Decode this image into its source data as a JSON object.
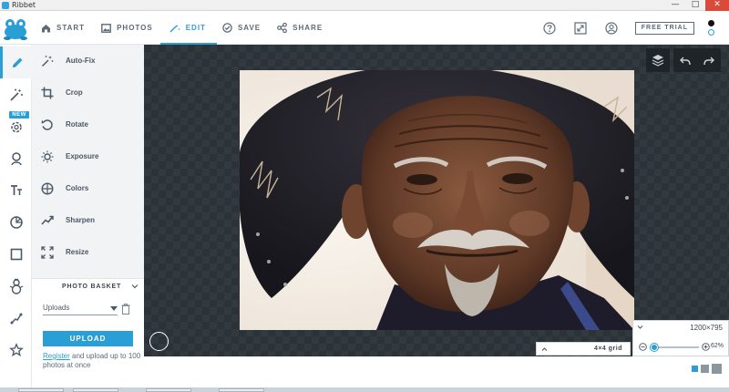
{
  "window": {
    "title": "Ribbet",
    "controls": {
      "minimize": "—",
      "maximize": "□",
      "close": "✕"
    }
  },
  "nav": {
    "items": [
      {
        "label": "START",
        "icon": "home-icon"
      },
      {
        "label": "PHOTOS",
        "icon": "photos-icon"
      },
      {
        "label": "EDIT",
        "icon": "magic-wand-icon",
        "active": true
      },
      {
        "label": "SAVE",
        "icon": "check-circle-icon"
      },
      {
        "label": "SHARE",
        "icon": "share-icon"
      }
    ],
    "free_trial": "FREE TRIAL"
  },
  "icon_rail": {
    "new_badge": "NEW",
    "items": [
      "pencil-icon",
      "magic-wand-icon",
      "gear-icon",
      "person-icon",
      "text-icon",
      "sticker-icon",
      "frame-icon",
      "snowman-icon",
      "stroke-icon",
      "star-icon"
    ]
  },
  "tools": [
    {
      "label": "Auto-Fix",
      "icon": "auto-fix-icon"
    },
    {
      "label": "Crop",
      "icon": "crop-icon"
    },
    {
      "label": "Rotate",
      "icon": "rotate-icon"
    },
    {
      "label": "Exposure",
      "icon": "exposure-icon"
    },
    {
      "label": "Colors",
      "icon": "colors-icon"
    },
    {
      "label": "Sharpen",
      "icon": "sharpen-icon"
    },
    {
      "label": "Resize",
      "icon": "resize-icon"
    }
  ],
  "basket": {
    "title": "PHOTO BASKET",
    "select_value": "Uploads",
    "upload_label": "UPLOAD",
    "register_link": "Register",
    "register_text": " and upload up to 100 photos at once"
  },
  "canvas": {
    "grid_label": "4×4 grid",
    "dimensions": "1200×795",
    "zoom": "62%",
    "zoom_fraction": 0.1
  },
  "colors": {
    "accent": "#2a9fd6",
    "canvas_bg": "#2c3338",
    "panel_bg": "#f1f3f4",
    "text": "#4b5866"
  }
}
